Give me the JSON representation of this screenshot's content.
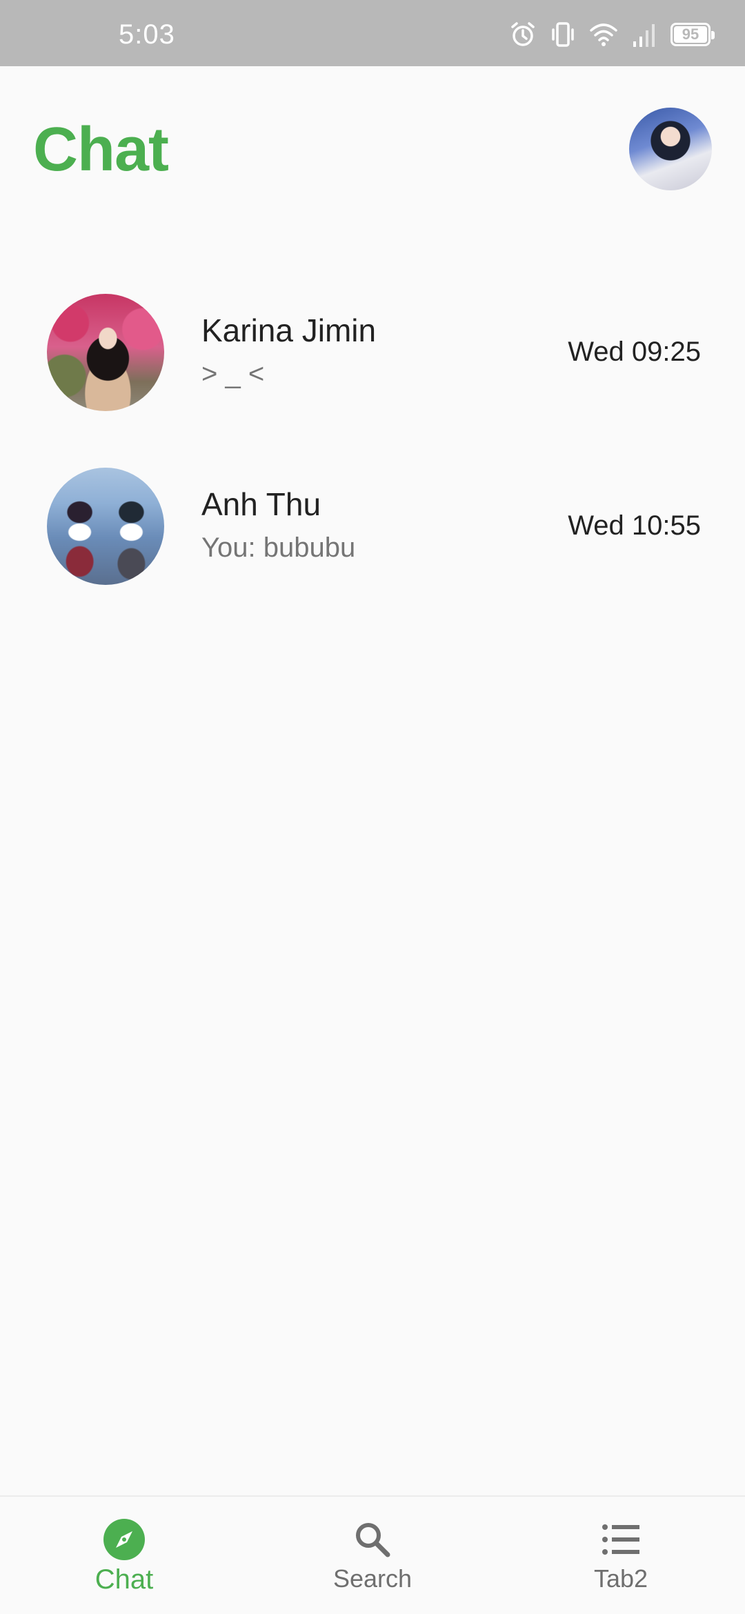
{
  "status_bar": {
    "time": "5:03",
    "battery_level": "95",
    "icons": [
      "alarm-icon",
      "vibrate-icon",
      "wifi-icon",
      "signal-icon",
      "battery-icon"
    ]
  },
  "header": {
    "title": "Chat",
    "profile_avatar": "profile-avatar"
  },
  "chats": [
    {
      "name": "Karina Jimin",
      "preview": "> _ <",
      "time": "Wed 09:25"
    },
    {
      "name": "Anh Thu",
      "preview": "You: bububu",
      "time": "Wed 10:55"
    }
  ],
  "bottom_nav": {
    "items": [
      {
        "label": "Chat",
        "icon": "compass-icon",
        "active": true
      },
      {
        "label": "Search",
        "icon": "search-icon",
        "active": false
      },
      {
        "label": "Tab2",
        "icon": "list-icon",
        "active": false
      }
    ]
  },
  "colors": {
    "accent": "#4caf50",
    "status_bar": "#b8b8b8",
    "background": "#fafafa",
    "text_primary": "#222222",
    "text_secondary": "#757575"
  }
}
